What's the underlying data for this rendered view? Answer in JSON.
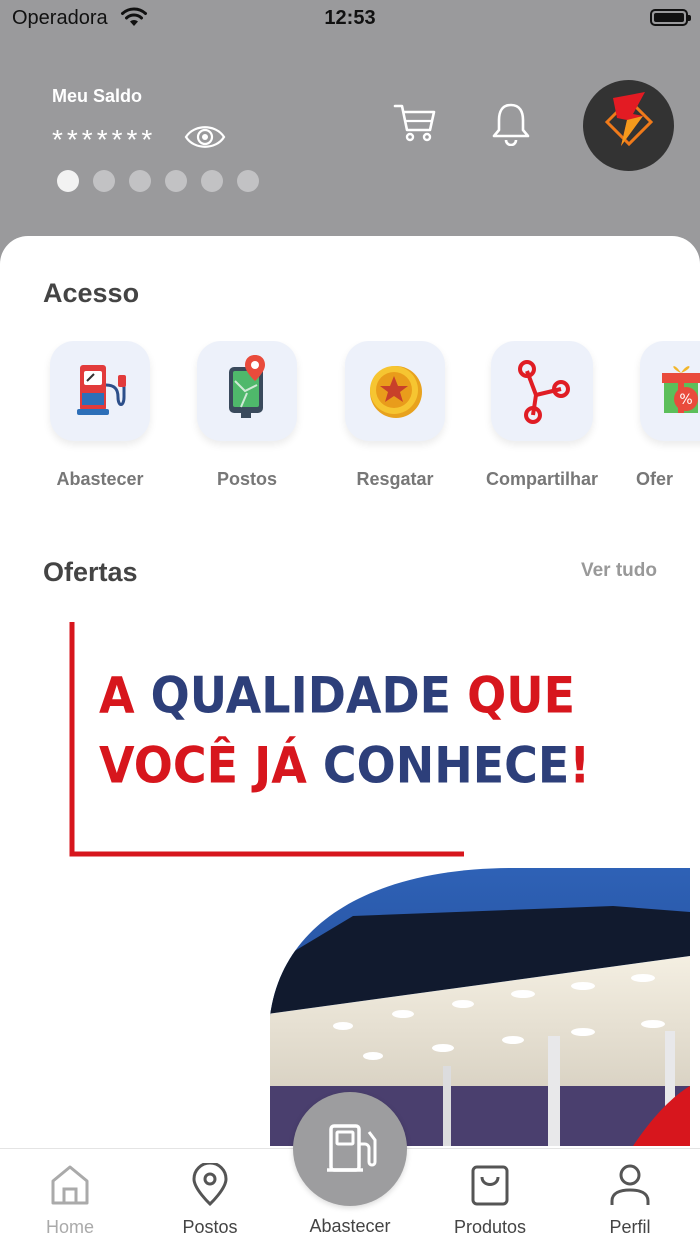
{
  "status_bar": {
    "carrier": "Operadora",
    "time": "12:53"
  },
  "header": {
    "balance_label": "Meu Saldo",
    "balance_value": "*******",
    "carousel_dots": 6,
    "carousel_active": 1,
    "icons": [
      "eye-icon",
      "cart-icon",
      "bell-icon",
      "brand-logo"
    ]
  },
  "access": {
    "title": "Acesso",
    "items": [
      {
        "label": "Abastecer",
        "icon": "fuel-pump-icon"
      },
      {
        "label": "Postos",
        "icon": "map-location-icon"
      },
      {
        "label": "Resgatar",
        "icon": "star-coin-icon"
      },
      {
        "label": "Compartilhar",
        "icon": "share-icon"
      },
      {
        "label": "Ofer",
        "icon": "gift-icon"
      }
    ]
  },
  "offers": {
    "title": "Ofertas",
    "see_all": "Ver tudo",
    "banner": {
      "line1_a": "A ",
      "line1_b": "QUALIDADE ",
      "line1_c": "QUE",
      "line2_a": "VOCÊ JÁ ",
      "line2_b": "CONHECE",
      "line2_c": "!"
    }
  },
  "nav": {
    "home": "Home",
    "postos": "Postos",
    "abastecer": "Abastecer",
    "produtos": "Produtos",
    "perfil": "Perfil"
  },
  "colors": {
    "header_bg": "#9a9a9c",
    "brand_red": "#d7161d",
    "brand_navy": "#2d3f7a",
    "tile_bg": "#edf1fa"
  }
}
